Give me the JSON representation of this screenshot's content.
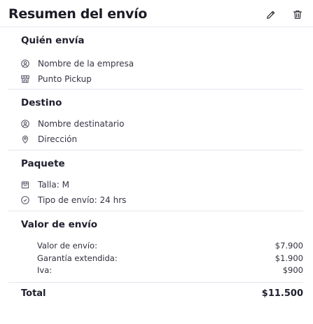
{
  "header": {
    "title": "Resumen del envío",
    "edit_icon": "pencil-icon",
    "delete_icon": "trash-icon"
  },
  "sender": {
    "title": "Quién envía",
    "items": [
      {
        "icon": "user-circle-icon",
        "label": "Nombre de la empresa"
      },
      {
        "icon": "store-icon",
        "label": "Punto Pickup"
      }
    ]
  },
  "destination": {
    "title": "Destino",
    "items": [
      {
        "icon": "user-circle-icon",
        "label": "Nombre destinatario"
      },
      {
        "icon": "location-pin-icon",
        "label": "Dirección"
      }
    ]
  },
  "package": {
    "title": "Paquete",
    "items": [
      {
        "icon": "package-icon",
        "label": "Talla: M"
      },
      {
        "icon": "clock-check-icon",
        "label": "Tipo de envío: 24 hrs"
      }
    ]
  },
  "shipping_value": {
    "title": "Valor de envío",
    "rows": [
      {
        "label": "Valor de envío:",
        "value": "$7.900"
      },
      {
        "label": "Garantía extendida:",
        "value": "$1.900"
      },
      {
        "label": "Iva:",
        "value": "$900"
      }
    ]
  },
  "total": {
    "label": "Total",
    "value": "$11.500"
  },
  "colors": {
    "text": "#1d1d2b",
    "divider": "#e6e6ef",
    "icon": "#555566"
  }
}
